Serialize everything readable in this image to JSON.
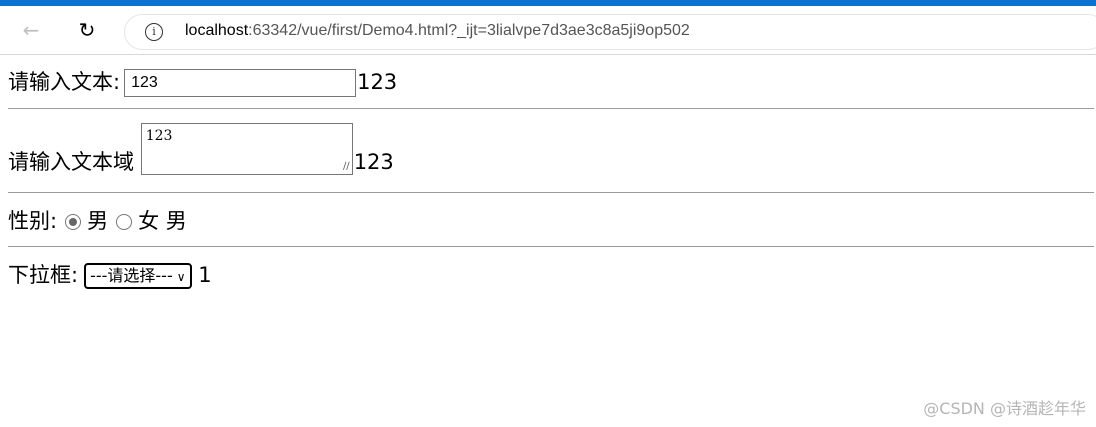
{
  "browser": {
    "url_host": "localhost",
    "url_rest": ":63342/vue/first/Demo4.html?_ijt=3lialvpe7d3ae3c8a5ji9op502"
  },
  "form": {
    "text": {
      "label": "请输入文本:",
      "value": "123",
      "echo": "123"
    },
    "textarea": {
      "label": "请输入文本域",
      "value": "123",
      "echo": "123"
    },
    "gender": {
      "label": "性别:",
      "option_male": "男",
      "option_female": "女",
      "selected": "男",
      "echo": "男"
    },
    "dropdown": {
      "label": "下拉框:",
      "selected_option": "---请选择---",
      "echo": "1"
    }
  },
  "watermark": "@CSDN @诗酒趁年华"
}
